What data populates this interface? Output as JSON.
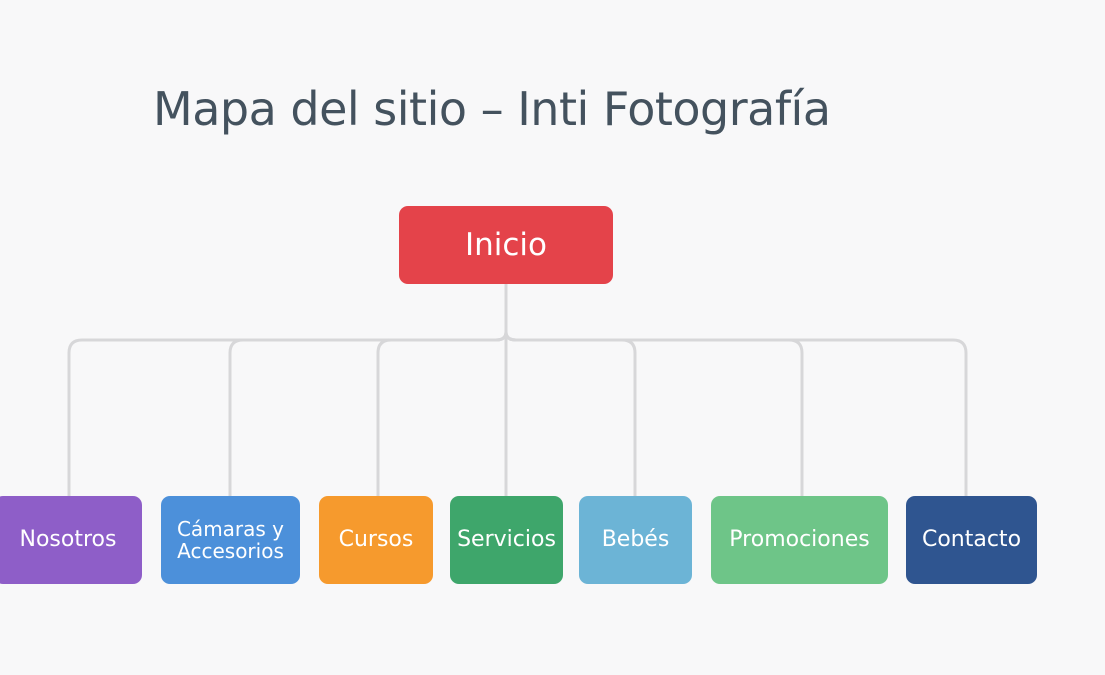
{
  "title": "Mapa del sitio – Inti Fotografía",
  "root": {
    "label": "Inicio",
    "color": "#e4434a"
  },
  "children": [
    {
      "id": "nosotros",
      "label": "Nosotros",
      "color": "#8e5ec8"
    },
    {
      "id": "camaras",
      "label": "Cámaras y Accesorios",
      "line1": "Cámaras y",
      "line2": "Accesorios",
      "color": "#4c90da"
    },
    {
      "id": "cursos",
      "label": "Cursos",
      "color": "#f69a2d"
    },
    {
      "id": "servicios",
      "label": "Servicios",
      "color": "#3ea66b"
    },
    {
      "id": "bebes",
      "label": "Bebés",
      "color": "#6cb4d6"
    },
    {
      "id": "promociones",
      "label": "Promociones",
      "color": "#6ec588"
    },
    {
      "id": "contacto",
      "label": "Contacto",
      "color": "#2f5590"
    }
  ],
  "connector_color": "#d7d7d9"
}
